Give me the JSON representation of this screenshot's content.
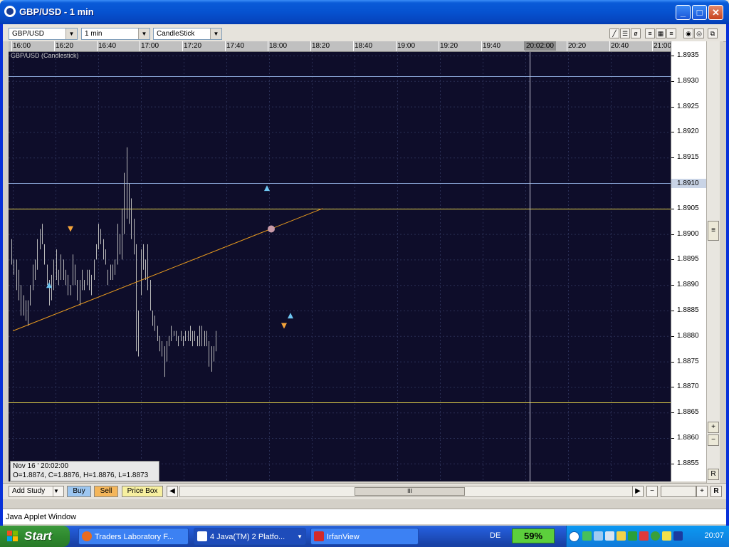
{
  "window": {
    "title": "GBP/USD - 1 min",
    "min_label": "_",
    "max_label": "□",
    "close_label": "✕"
  },
  "toolbar": {
    "symbol": "GBP/USD",
    "interval": "1 min",
    "chart_style": "CandleStick",
    "drawing_tools": [
      "line-tool-icon",
      "channel-tool-icon",
      "ellipse-tool-icon",
      "fibonacci-tool-icon",
      "grid-tool-icon",
      "hlines-tool-icon",
      "zoom-in-icon",
      "zoom-out-icon",
      "detach-icon"
    ]
  },
  "chart": {
    "label": "GBP/USD (Candlestick)",
    "time_ticks": [
      "16:00",
      "16:20",
      "16:40",
      "17:00",
      "17:20",
      "17:40",
      "18:00",
      "18:20",
      "18:40",
      "19:00",
      "19:20",
      "19:40",
      "20:02:00",
      "20:20",
      "20:40",
      "21:00"
    ],
    "price_ticks": [
      "1.8935",
      "1.8930",
      "1.8925",
      "1.8920",
      "1.8915",
      "1.8910",
      "1.8905",
      "1.8900",
      "1.8895",
      "1.8890",
      "1.8885",
      "1.8880",
      "1.8875",
      "1.8870",
      "1.8865",
      "1.8860",
      "1.8855"
    ],
    "cursor_price": "1.8910",
    "cursor_time": "20:02:00",
    "ohlc_date": "Nov 16 ' 20:02:00",
    "ohlc_values": "O=1.8874, C=1.8876, H=1.8876, L=1.8873",
    "colors": {
      "background": "#0e0d2a",
      "bars": "#b8b8b8",
      "horizontal_lines": "#e6d44a",
      "trendline": "#e89a1e",
      "buy_marker": "#6ec6f2",
      "sell_marker": "#f4a43a"
    }
  },
  "chart_data": {
    "type": "bar",
    "title": "GBP/USD (Candlestick)",
    "x_range": [
      "16:00",
      "21:00"
    ],
    "ylim": [
      1.8853,
      1.8937
    ],
    "horizontal_lines": [
      1.8931,
      1.891,
      1.8905,
      1.8867
    ],
    "trendline": {
      "from": [
        "16:00",
        1.8881
      ],
      "to": [
        "18:25",
        1.8905
      ]
    },
    "series": [
      {
        "values": [
          [
            1.8899,
            1.8894
          ],
          [
            1.8895,
            1.8892
          ],
          [
            1.8895,
            1.8889
          ],
          [
            1.8893,
            1.8887
          ],
          [
            1.889,
            1.8884
          ],
          [
            1.8888,
            1.8884
          ],
          [
            1.8887,
            1.8883
          ],
          [
            1.8887,
            1.8882
          ],
          [
            1.889,
            1.8886
          ],
          [
            1.8894,
            1.8889
          ],
          [
            1.8895,
            1.8891
          ],
          [
            1.8899,
            1.8893
          ],
          [
            1.8901,
            1.8897
          ],
          [
            1.8902,
            1.8898
          ],
          [
            1.8898,
            1.8894
          ],
          [
            1.8894,
            1.889
          ],
          [
            1.8891,
            1.8886
          ],
          [
            1.8892,
            1.8887
          ],
          [
            1.8895,
            1.8889
          ],
          [
            1.8897,
            1.8891
          ],
          [
            1.8893,
            1.889
          ],
          [
            1.8896,
            1.8891
          ],
          [
            1.8895,
            1.8891
          ],
          [
            1.8893,
            1.889
          ],
          [
            1.8892,
            1.8888
          ],
          [
            1.889,
            1.8888
          ],
          [
            1.8896,
            1.889
          ],
          [
            1.8894,
            1.889
          ],
          [
            1.8891,
            1.8887
          ],
          [
            1.8891,
            1.8886
          ],
          [
            1.8893,
            1.8889
          ],
          [
            1.8891,
            1.8889
          ],
          [
            1.8893,
            1.889
          ],
          [
            1.8893,
            1.8889
          ],
          [
            1.8892,
            1.8888
          ],
          [
            1.8895,
            1.8891
          ],
          [
            1.8898,
            1.8895
          ],
          [
            1.8902,
            1.8897
          ],
          [
            1.8901,
            1.8898
          ],
          [
            1.8899,
            1.8895
          ],
          [
            1.8897,
            1.8894
          ],
          [
            1.8893,
            1.889
          ],
          [
            1.8894,
            1.8891
          ],
          [
            1.8894,
            1.8891
          ],
          [
            1.8895,
            1.8892
          ],
          [
            1.8902,
            1.8894
          ],
          [
            1.89,
            1.8896
          ],
          [
            1.8905,
            1.8895
          ],
          [
            1.8912,
            1.89
          ],
          [
            1.8917,
            1.8903
          ],
          [
            1.891,
            1.8902
          ],
          [
            1.8907,
            1.8899
          ],
          [
            1.8903,
            1.8896
          ],
          [
            1.8898,
            1.8877
          ],
          [
            1.8885,
            1.8876
          ],
          [
            1.8897,
            1.8888
          ],
          [
            1.8898,
            1.8893
          ],
          [
            1.8895,
            1.8891
          ],
          [
            1.8898,
            1.8889
          ],
          [
            1.8891,
            1.8885
          ],
          [
            1.8885,
            1.8882
          ],
          [
            1.8884,
            1.8881
          ],
          [
            1.8882,
            1.8879
          ],
          [
            1.888,
            1.8877
          ],
          [
            1.8879,
            1.8876
          ],
          [
            1.8878,
            1.8872
          ],
          [
            1.8879,
            1.8875
          ],
          [
            1.888,
            1.8878
          ],
          [
            1.8882,
            1.8879
          ],
          [
            1.8881,
            1.888
          ],
          [
            1.8881,
            1.8879
          ],
          [
            1.888,
            1.8878
          ],
          [
            1.8881,
            1.8879
          ],
          [
            1.888,
            1.8878
          ],
          [
            1.8881,
            1.8879
          ],
          [
            1.8881,
            1.8879
          ],
          [
            1.8882,
            1.8879
          ],
          [
            1.8881,
            1.8878
          ],
          [
            1.8881,
            1.8879
          ],
          [
            1.888,
            1.8878
          ],
          [
            1.8882,
            1.8878
          ],
          [
            1.8882,
            1.8878
          ],
          [
            1.8881,
            1.8878
          ],
          [
            1.8881,
            1.8878
          ],
          [
            1.8879,
            1.8874
          ],
          [
            1.8878,
            1.8873
          ],
          [
            1.8878,
            1.8875
          ],
          [
            1.8881,
            1.8877
          ]
        ]
      }
    ],
    "markers": [
      {
        "type": "buy",
        "time": "16:17",
        "price": 1.889
      },
      {
        "type": "sell",
        "time": "16:27",
        "price": 1.8901
      },
      {
        "type": "buy",
        "time": "17:59",
        "price": 1.8909
      },
      {
        "type": "exit",
        "time": "18:01",
        "price": 1.8901
      },
      {
        "type": "sell",
        "time": "18:07",
        "price": 1.8882
      },
      {
        "type": "buy",
        "time": "18:10",
        "price": 1.8884
      }
    ]
  },
  "bottom": {
    "add_study": "Add Study",
    "buy": "Buy",
    "sell": "Sell",
    "price_box": "Price Box",
    "scroll_thumb": "III"
  },
  "status": {
    "applet": "Java Applet Window"
  },
  "taskbar": {
    "start": "Start",
    "tasks": [
      "Traders Laboratory F...",
      "4 Java(TM) 2 Platfo...",
      "IrfanView"
    ],
    "lang": "DE",
    "battery": "59%",
    "clock": "20:07"
  }
}
